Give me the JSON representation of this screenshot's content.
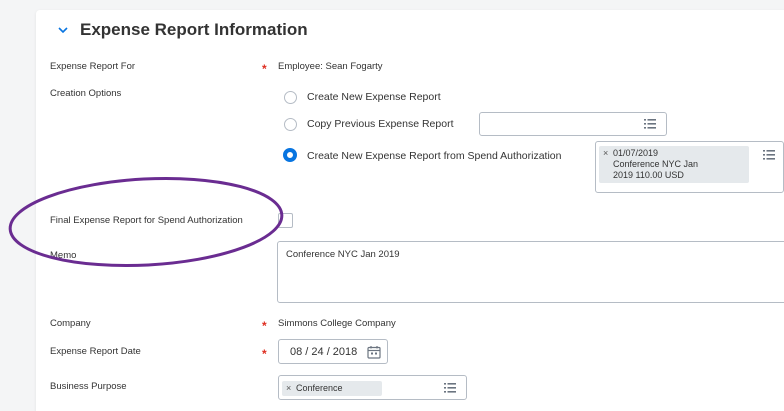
{
  "section": {
    "title": "Expense Report Information"
  },
  "fields": {
    "expense_report_for": {
      "label": "Expense Report For",
      "value": "Employee: Sean Fogarty"
    },
    "creation_options": {
      "label": "Creation Options",
      "options": [
        {
          "label": "Create New Expense Report",
          "selected": false
        },
        {
          "label": "Copy Previous Expense Report",
          "selected": false
        },
        {
          "label": "Create New Expense Report from Spend Authorization",
          "selected": true
        }
      ],
      "spend_authorization_pill": [
        "01/07/2019",
        "Conference NYC Jan",
        "2019 110.00 USD"
      ]
    },
    "final_expense_report": {
      "label": "Final Expense Report for Spend Authorization",
      "checked": false
    },
    "memo": {
      "label": "Memo",
      "value": "Conference NYC Jan 2019"
    },
    "company": {
      "label": "Company",
      "value": "Simmons College Company"
    },
    "expense_report_date": {
      "label": "Expense Report Date",
      "value": "08 / 24 / 2018"
    },
    "business_purpose": {
      "label": "Business Purpose",
      "value": "Conference"
    }
  },
  "colors": {
    "accent": "#0875e1",
    "required": "#de2e21",
    "annotation": "#6a2c91",
    "pill": "#e5e9ec"
  },
  "icons": [
    "chevron-down-icon",
    "list-icon",
    "calendar-icon",
    "close-icon"
  ]
}
